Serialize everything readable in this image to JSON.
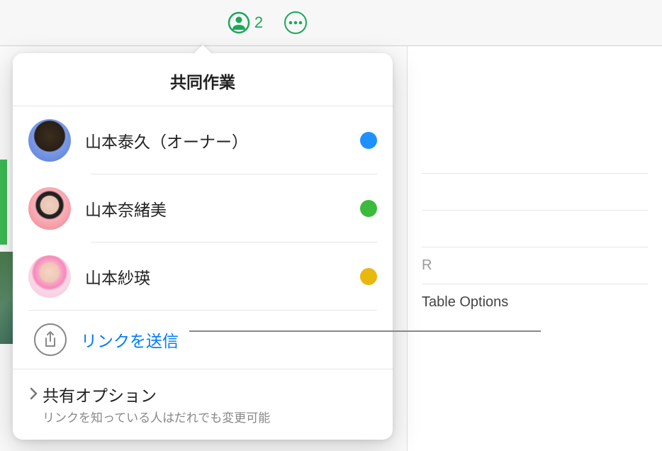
{
  "toolbar": {
    "collab_count": "2",
    "bg_sidebar_items": [
      "",
      "",
      "R",
      "Table Options"
    ]
  },
  "popover": {
    "title": "共同作業",
    "participants": [
      {
        "name": "山本泰久（オーナー）",
        "dot_color": "#1e90ff"
      },
      {
        "name": "山本奈緒美",
        "dot_color": "#3cba3c"
      },
      {
        "name": "山本紗瑛",
        "dot_color": "#e8b80e"
      }
    ],
    "send_link_label": "リンクを送信",
    "share_options": {
      "title": "共有オプション",
      "subtitle": "リンクを知っている人はだれでも変更可能"
    }
  }
}
